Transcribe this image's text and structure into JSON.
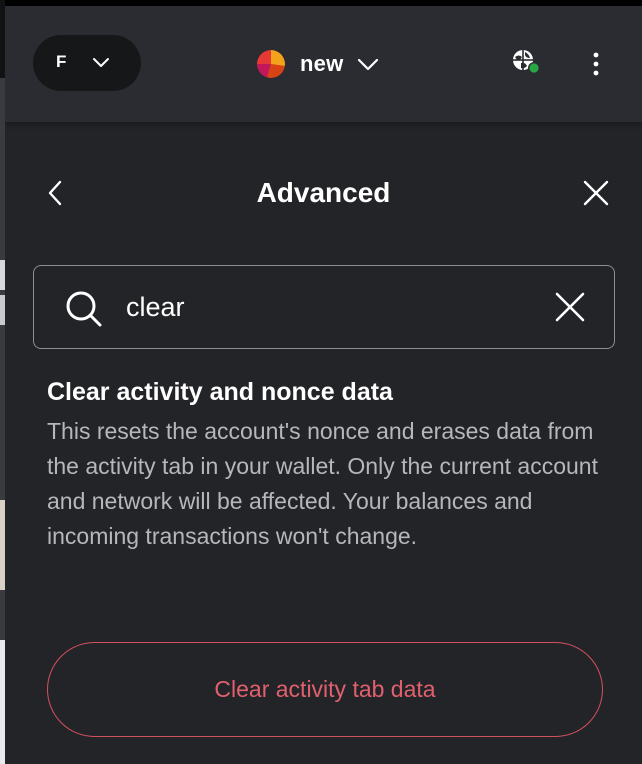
{
  "header": {
    "network_letter": "F",
    "account_name": "new"
  },
  "page": {
    "title": "Advanced"
  },
  "search": {
    "value": "clear"
  },
  "result": {
    "title": "Clear activity and nonce data",
    "description": "This resets the account's nonce and erases data from the activity tab in your wallet. Only the current account and network will be affected. Your balances and incoming transactions won't change.",
    "button_label": "Clear activity tab data"
  },
  "icons": {
    "network_chevron": "chevron-down-icon",
    "account_chevron": "chevron-down-icon",
    "globe": "globe-connected-icon",
    "menu": "kebab-menu-icon",
    "back": "chevron-left-icon",
    "close": "close-icon",
    "search": "search-icon",
    "clear": "clear-icon"
  },
  "colors": {
    "background": "#232428",
    "header": "#2b2c31",
    "danger": "#e0606e",
    "connected_dot": "#28a745"
  }
}
